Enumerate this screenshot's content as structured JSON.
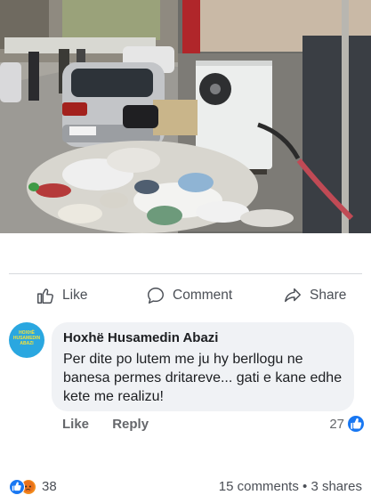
{
  "post": {
    "photo_alt": "Street with piled garbage bags next to a parked car and an air conditioning unit",
    "reactions": {
      "types": [
        "like",
        "angry"
      ],
      "count": "38"
    },
    "comments_label": "15 comments",
    "shares_label": "3 shares",
    "separator": "•"
  },
  "actions": {
    "like": "Like",
    "comment": "Comment",
    "share": "Share"
  },
  "comment": {
    "author": "Hoxhë Husamedin Abazi",
    "text": "Per dite po lutem me ju hy berllogu ne banesa permes dritareve... gati e kane edhe kete me realizu!",
    "avatar_text": "HOXHË HUSAMEDIN ABAZI",
    "like_label": "Like",
    "reply_label": "Reply",
    "like_count": "27"
  },
  "colors": {
    "accent": "#1877f2",
    "angry": "#f28b1d",
    "muted": "#65676b"
  }
}
